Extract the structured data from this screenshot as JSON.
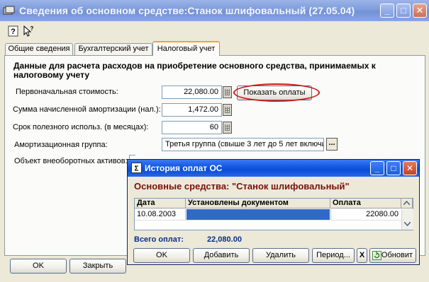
{
  "window": {
    "title": "Сведения об основном средстве:Станок шлифовальный (27.05.04)",
    "controls": {
      "minimize": "_",
      "maximize": "□",
      "close": "✕"
    }
  },
  "toolbar": {
    "icons": [
      "help-icon",
      "whats-this-icon"
    ]
  },
  "tabs": [
    {
      "label": "Общие сведения",
      "active": false
    },
    {
      "label": "Бухгалтерский учет",
      "active": false
    },
    {
      "label": "Налоговый учет",
      "active": true
    }
  ],
  "tax_tab": {
    "heading": "Данные для расчета расходов на приобретение основного средства, принимаемых к налоговому учету",
    "fields": {
      "initial_cost": {
        "label": "Первоначальная стоимость:",
        "value": "22,080.00"
      },
      "depreciation": {
        "label": "Сумма начисленной амортизации (нал.):",
        "value": "1,472.00"
      },
      "useful_life": {
        "label": "Срок полезного использ. (в месяцах):",
        "value": "60"
      },
      "depreciation_group": {
        "label": "Амортизационная группа:",
        "value": "Третья группа (свыше 3 лет до 5 лет включи"
      },
      "object": {
        "label": "Объект внеоборотных активов:"
      }
    },
    "show_payments_button": "Показать оплаты",
    "ok_button": "OK",
    "close_button": "Закрыть"
  },
  "dialog": {
    "title": "История оплат ОС",
    "controls": {
      "minimize": "_",
      "maximize": "□",
      "close": "✕"
    },
    "heading": "Основные средства: \"Станок шлифовальный\"",
    "table": {
      "columns": [
        "Дата",
        "Установлены документом",
        "Оплата"
      ],
      "rows": [
        {
          "date": "10.08.2003",
          "document": "",
          "amount": "22080.00"
        }
      ]
    },
    "total_label": "Всего оплат:",
    "total_value": "22,080.00",
    "buttons": {
      "ok": "OK",
      "add": "Добавить",
      "delete": "Удалить",
      "period": "Период...",
      "clear_period": "X",
      "refresh": "Обновит"
    }
  },
  "colors": {
    "highlight_circle": "#d01818",
    "dialog_heading": "#7a1010",
    "selection": "#316ac5",
    "total_text": "#0b2d8a"
  }
}
